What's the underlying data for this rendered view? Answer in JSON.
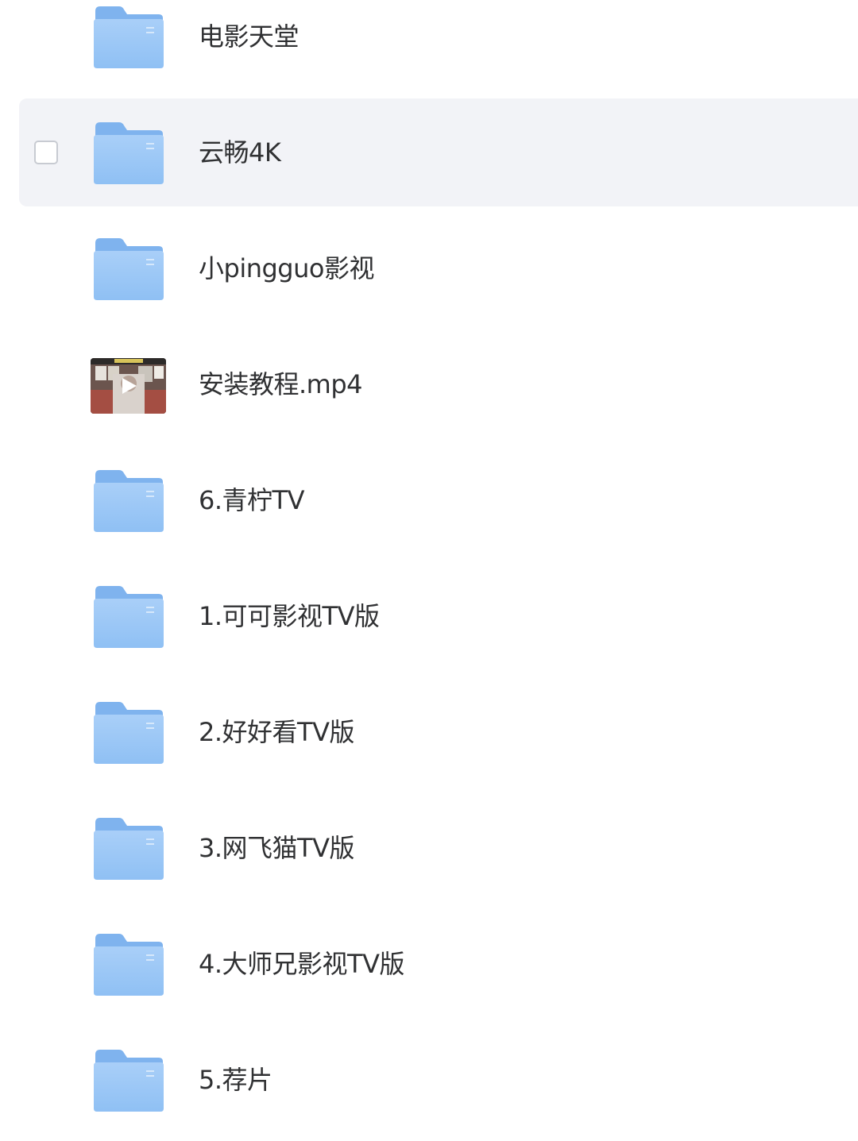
{
  "colors": {
    "folder_back": "#7fb3ee",
    "folder_front": "#a9cff8",
    "selected_row_bg": "#f2f3f7",
    "text": "#303133"
  },
  "files": [
    {
      "name": "电影天堂",
      "type": "folder",
      "icon": "folder-icon",
      "selected": false
    },
    {
      "name": "云畅4K",
      "type": "folder",
      "icon": "folder-icon",
      "selected": true
    },
    {
      "name": "小pingguo影视",
      "type": "folder",
      "icon": "folder-icon",
      "selected": false
    },
    {
      "name": "安装教程.mp4",
      "type": "video",
      "icon": "video-thumbnail-icon",
      "selected": false
    },
    {
      "name": "6.青柠TV",
      "type": "folder",
      "icon": "folder-icon",
      "selected": false
    },
    {
      "name": "1.可可影视TV版",
      "type": "folder",
      "icon": "folder-icon",
      "selected": false
    },
    {
      "name": "2.好好看TV版",
      "type": "folder",
      "icon": "folder-icon",
      "selected": false
    },
    {
      "name": "3.网飞猫TV版",
      "type": "folder",
      "icon": "folder-icon",
      "selected": false
    },
    {
      "name": "4.大师兄影视TV版",
      "type": "folder",
      "icon": "folder-icon",
      "selected": false
    },
    {
      "name": "5.荐片",
      "type": "folder",
      "icon": "folder-icon",
      "selected": false
    }
  ]
}
